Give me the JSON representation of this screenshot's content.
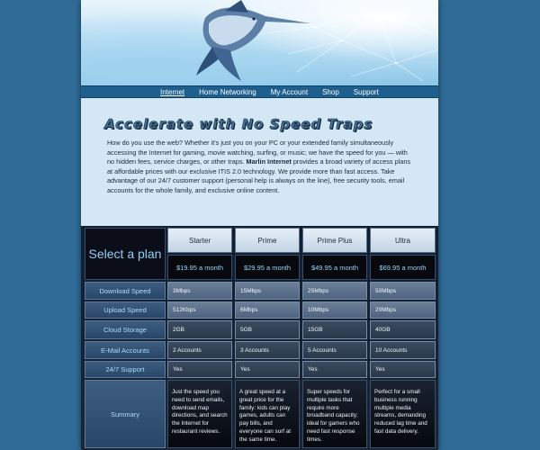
{
  "nav": {
    "items": [
      "Internet",
      "Home Networking",
      "My Account",
      "Shop",
      "Support"
    ]
  },
  "intro": {
    "headline": "Accelerate with No Speed Traps",
    "text_part1": "How do you use the web? Whether it's just you on your PC or your extended family simultaneously accessing the Internet for gaming, movie watching, surfing, or music; we have the speed for you — with no hidden fees, service charges, or other traps. ",
    "brand": "Marlin Internet",
    "text_part2": " provides a broad variety of access plans at affordable prices with our exclusive ITIS 2.0 technology. We provide more than fast access. Take advantage of our 24/7 customer support (personal help is always on the line), free security tools, email accounts for the whole family, and exclusive online content."
  },
  "plans": {
    "select_label": "Select a plan",
    "columns": [
      {
        "name": "Starter",
        "price": "$19.95 a month"
      },
      {
        "name": "Prime",
        "price": "$29.95 a month"
      },
      {
        "name": "Prime Plus",
        "price": "$49.95 a month"
      },
      {
        "name": "Ultra",
        "price": "$69.95 a month"
      }
    ],
    "rows": [
      {
        "label": "Download Speed",
        "values": [
          "3Mbps",
          "15Mbps",
          "25Mbps",
          "50Mbps"
        ]
      },
      {
        "label": "Upload Speed",
        "values": [
          "512Kbps",
          "6Mbps",
          "10Mbps",
          "20Mbps"
        ]
      },
      {
        "label": "Cloud Storage",
        "values": [
          "2GB",
          "5GB",
          "15GB",
          "40GB"
        ]
      },
      {
        "label": "E-Mail Accounts",
        "values": [
          "2 Accounts",
          "3 Accounts",
          "5 Accounts",
          "10 Accounts"
        ]
      },
      {
        "label": "24/7 Support",
        "values": [
          "Yes",
          "Yes",
          "Yes",
          "Yes"
        ]
      }
    ],
    "summary": {
      "label": "Summary",
      "values": [
        "Just the speed you need to send emails, download map directions, and search the Internet for restaurant reviews.",
        "A great speed at a great price for the family: kids can play games, adults can pay bills, and everyone can surf at the same time.",
        "Super speeds for multiple tasks that require more broadband capacity; ideal for gamers who need fast response times.",
        "Perfect for a small business running multiple media streams, demanding reduced lag time and fast data delivery."
      ]
    }
  },
  "colors": {
    "background": "#2f6b96",
    "nav": "#1e5f8d",
    "accent_text": "#8fd0f5"
  }
}
